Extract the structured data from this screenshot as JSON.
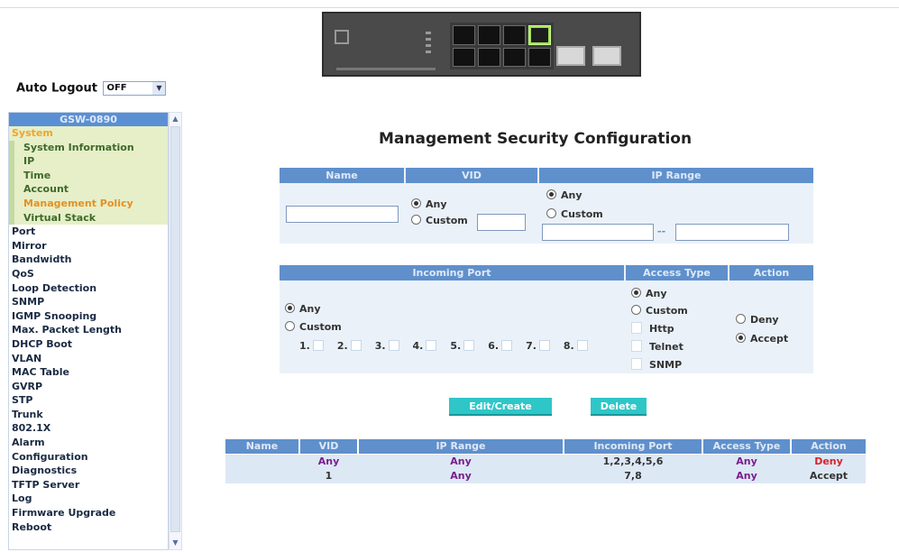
{
  "header": {
    "auto_logout_label": "Auto Logout",
    "auto_logout_value": "OFF"
  },
  "menu": {
    "device": "GSW-0890",
    "items": [
      {
        "label": "System",
        "kind": "sys"
      },
      {
        "label": "System Information",
        "kind": "sub"
      },
      {
        "label": "IP",
        "kind": "sub"
      },
      {
        "label": "Time",
        "kind": "sub"
      },
      {
        "label": "Account",
        "kind": "sub"
      },
      {
        "label": "Management Policy",
        "kind": "sub-active"
      },
      {
        "label": "Virtual Stack",
        "kind": "sub"
      },
      {
        "label": "Port",
        "kind": "top"
      },
      {
        "label": "Mirror",
        "kind": "top"
      },
      {
        "label": "Bandwidth",
        "kind": "top"
      },
      {
        "label": "QoS",
        "kind": "top"
      },
      {
        "label": "Loop Detection",
        "kind": "top"
      },
      {
        "label": "SNMP",
        "kind": "top"
      },
      {
        "label": "IGMP Snooping",
        "kind": "top"
      },
      {
        "label": "Max. Packet Length",
        "kind": "top"
      },
      {
        "label": "DHCP Boot",
        "kind": "top"
      },
      {
        "label": "VLAN",
        "kind": "top"
      },
      {
        "label": "MAC Table",
        "kind": "top"
      },
      {
        "label": "GVRP",
        "kind": "top"
      },
      {
        "label": "STP",
        "kind": "top"
      },
      {
        "label": "Trunk",
        "kind": "top"
      },
      {
        "label": "802.1X",
        "kind": "top"
      },
      {
        "label": "Alarm",
        "kind": "top"
      },
      {
        "label": "Configuration",
        "kind": "top"
      },
      {
        "label": "Diagnostics",
        "kind": "top"
      },
      {
        "label": "TFTP Server",
        "kind": "top"
      },
      {
        "label": "Log",
        "kind": "top"
      },
      {
        "label": "Firmware Upgrade",
        "kind": "top"
      },
      {
        "label": "Reboot",
        "kind": "top"
      }
    ]
  },
  "main": {
    "title": "Management Security Configuration",
    "form1": {
      "headers": {
        "name": "Name",
        "vid": "VID",
        "ip_range": "IP Range"
      },
      "vid_any": "Any",
      "vid_custom": "Custom",
      "ip_any": "Any",
      "ip_custom": "Custom",
      "range_sep": "--",
      "name_value": "",
      "vid_value": "",
      "ip_from": "",
      "ip_to": ""
    },
    "form2": {
      "headers": {
        "incoming_port": "Incoming Port",
        "access_type": "Access Type",
        "action": "Action"
      },
      "port_any": "Any",
      "port_custom": "Custom",
      "ports": [
        "1.",
        "2.",
        "3.",
        "4.",
        "5.",
        "6.",
        "7.",
        "8."
      ],
      "access_any": "Any",
      "access_custom": "Custom",
      "access_http": "Http",
      "access_telnet": "Telnet",
      "access_snmp": "SNMP",
      "action_deny": "Deny",
      "action_accept": "Accept"
    },
    "buttons": {
      "edit_create": "Edit/Create",
      "delete": "Delete"
    },
    "list": {
      "headers": [
        "Name",
        "VID",
        "IP Range",
        "Incoming Port",
        "Access Type",
        "Action"
      ],
      "rows": [
        {
          "name": "",
          "vid": "Any",
          "ip_range": "Any",
          "incoming_port": "1,2,3,4,5,6",
          "access_type": "Any",
          "action": "Deny"
        },
        {
          "name": "",
          "vid": "1",
          "ip_range": "Any",
          "incoming_port": "7,8",
          "access_type": "Any",
          "action": "Accept"
        }
      ]
    }
  },
  "colors": {
    "header_blue": "#5f90cc",
    "panel_bg": "#eaf1f9",
    "button_teal": "#2fc6c8",
    "value_purple": "#7a1f8c",
    "deny_red": "#d9232a",
    "menu_orange": "#f2a42a"
  }
}
